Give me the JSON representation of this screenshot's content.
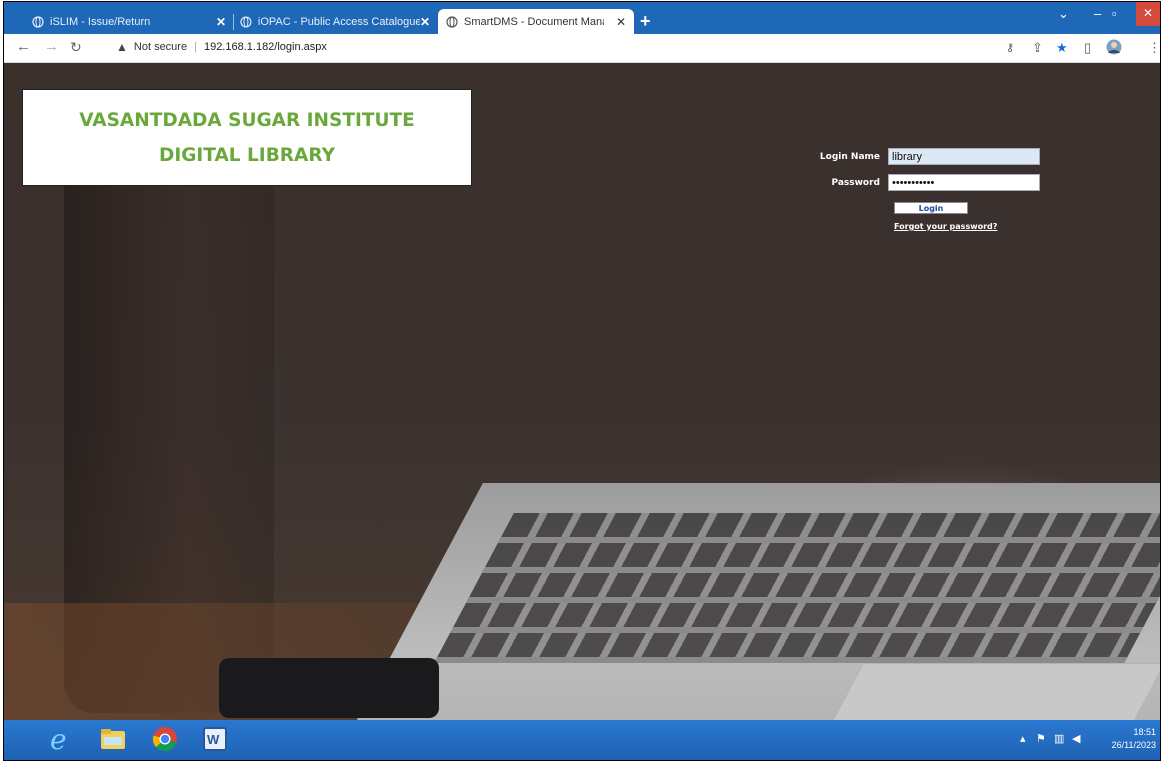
{
  "browser": {
    "tabs": [
      {
        "title": "iSLIM - Issue/Return",
        "active": false
      },
      {
        "title": "iOPAC - Public Access Catalogue",
        "active": false
      },
      {
        "title": "SmartDMS - Document Manager",
        "active": true
      }
    ],
    "new_tab": "+",
    "address": {
      "security_label": "Not secure",
      "url": "192.168.1.182/login.aspx"
    }
  },
  "logo": {
    "line1": "VASANTDADA SUGAR INSTITUTE",
    "line2": "DIGITAL LIBRARY",
    "color": "#6aa83c"
  },
  "login_form": {
    "login_name_label": "Login Name",
    "login_name_value": "library",
    "password_label": "Password",
    "password_value": "•••••••••••",
    "login_button": "Login",
    "forgot_link": "Forgot your password?"
  },
  "taskbar": {
    "apps": [
      "internet-explorer-icon",
      "file-explorer-icon",
      "chrome-icon",
      "word-icon"
    ],
    "clock_time": "18:51",
    "clock_date": "26/11/2023"
  },
  "colors": {
    "tabstrip": "#1f68b8",
    "taskbar": "#2a78d0"
  }
}
